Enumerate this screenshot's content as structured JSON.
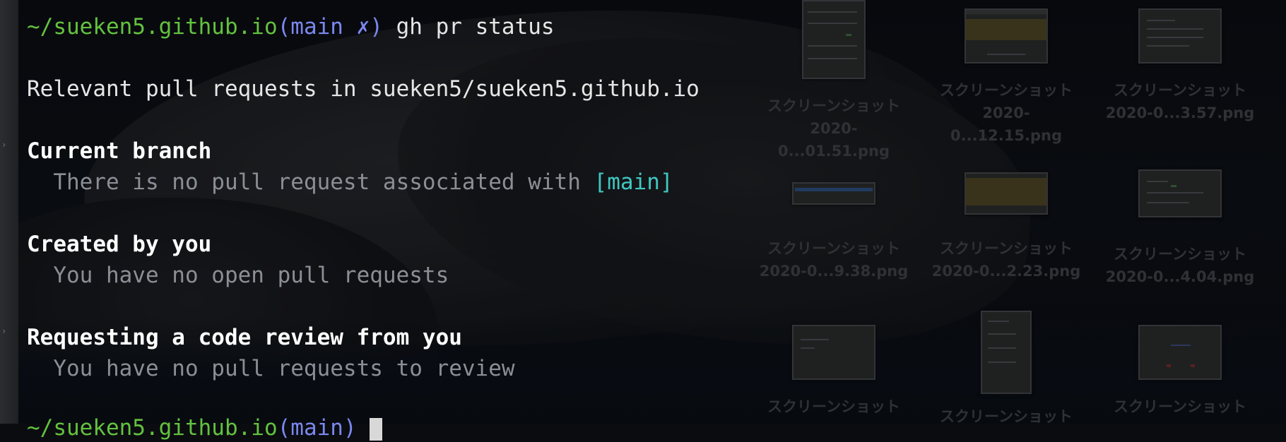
{
  "colors": {
    "prompt_path": "#63c23f",
    "prompt_branch": "#7b88ee",
    "text": "#e6e6e6",
    "dim_text": "#8b8f95",
    "branch_highlight": "#3fc8c2"
  },
  "terminal": {
    "prompt": {
      "path": "~/sueken5.github.io",
      "open_paren": "(",
      "branch": "main",
      "dirty_mark": "✗",
      "close_paren": ")",
      "command": "gh pr status"
    },
    "relevant_line": "Relevant pull requests in sueken5/sueken5.github.io",
    "sections": [
      {
        "heading": "Current branch",
        "message_prefix": "  There is no pull request associated with ",
        "message_highlight": "[main]"
      },
      {
        "heading": "Created by you",
        "message_prefix": "  You have no open pull requests",
        "message_highlight": ""
      },
      {
        "heading": "Requesting a code review from you",
        "message_prefix": "  You have no pull requests to review",
        "message_highlight": ""
      }
    ],
    "last_prompt": {
      "path": "~/sueken5.github.io",
      "branch": "main"
    }
  },
  "desktop": {
    "icons": [
      {
        "line1": "スクリーンショット",
        "line2": "2020-0...01.51.png",
        "icon": "screenshot-file-icon"
      },
      {
        "line1": "スクリーンショット",
        "line2": "2020-0...12.15.png",
        "icon": "screenshot-file-icon"
      },
      {
        "line1": "スクリーンショット",
        "line2": "2020-0...3.57.png",
        "icon": "screenshot-file-icon"
      },
      {
        "line1": "スクリーンショット",
        "line2": "2020-0...9.38.png",
        "icon": "screenshot-file-icon"
      },
      {
        "line1": "スクリーンショット",
        "line2": "2020-0...2.23.png",
        "icon": "screenshot-file-icon"
      },
      {
        "line1": "スクリーンショット",
        "line2": "2020-0...4.04.png",
        "icon": "screenshot-file-icon"
      },
      {
        "line1": "スクリーンショット",
        "line2": "",
        "icon": "screenshot-file-icon"
      },
      {
        "line1": "スクリーンショット",
        "line2": "",
        "icon": "screenshot-file-icon"
      },
      {
        "line1": "スクリーンショット",
        "line2": "",
        "icon": "screenshot-file-icon"
      }
    ]
  }
}
